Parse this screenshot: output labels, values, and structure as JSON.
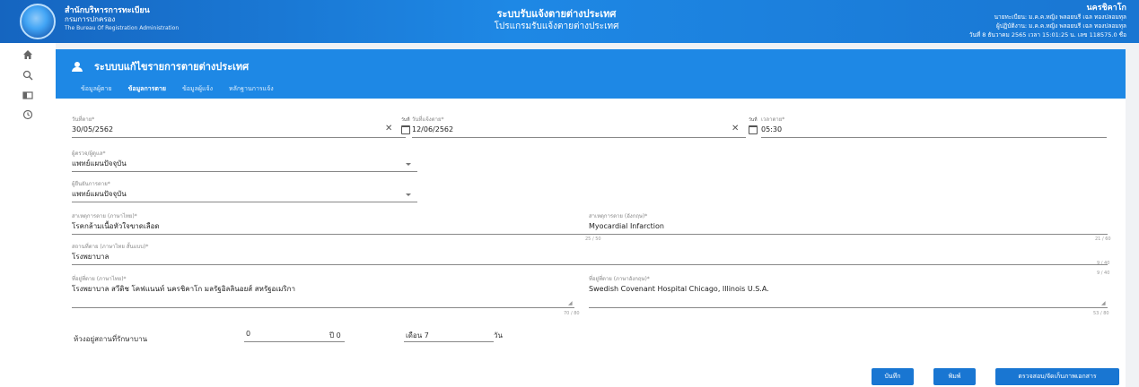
{
  "header": {
    "org_line1": "สำนักบริหารการทะเบียน",
    "org_line2": "กรมการปกครอง",
    "org_line3": "The Bureau Of Registration Administration",
    "title_line1": "ระบบรับแจ้งตายต่างประเทศ",
    "title_line2": "โปรแกรมรับแจ้งตายต่างประเทศ",
    "user_name": "นครชิคาโก",
    "user_line2": "นายทะเบียน: ม.ค.ค.หญิง พลอยนรี เฉล ทองปลอมทุล",
    "user_line3": "ผู้ปฏิบัติงาน: ม.ค.ค.หญิง พลอยนรี เฉล ทองปลอมทุล",
    "user_line4": "วันที่ 8 ธันวาคม 2565 เวลา 15:01:25 น. เลข 118575.0 ชื่อ"
  },
  "rail": {
    "icons": [
      "home-icon",
      "search-icon",
      "card-icon",
      "history-icon"
    ]
  },
  "panel": {
    "title": "ระบบบแก้ไขรายการตายต่างประเทศ",
    "tabs": [
      "ข้อมูลผู้ตาย",
      "ข้อมูลการตาย",
      "ข้อมูลผู้แจ้ง",
      "หลักฐานการแจ้ง"
    ],
    "active_tab": 1
  },
  "form": {
    "death_date": {
      "label": "วันที่ตาย*",
      "value": "30/05/2562"
    },
    "report_date": {
      "label": "วันที่แจ้งตาย*",
      "value": "12/06/2562",
      "cal_caption": "วันที่"
    },
    "death_time": {
      "label": "เวลาตาย*",
      "value": "05:30",
      "cal_caption": "วันที่"
    },
    "death_type": {
      "label": "ผู้ตรวจ/ผู้ดูแล*",
      "value": "แพทย์แผนปัจจุบัน"
    },
    "certifier": {
      "label": "ผู้ยืนยันการตาย*",
      "value": "แพทย์แผนปัจจุบัน"
    },
    "cause_th": {
      "label": "สาเหตุการตาย (ภาษาไทย)*",
      "value": "โรคกล้ามเนื้อหัวใจขาดเลือด",
      "counter": "25 / 50"
    },
    "cause_en": {
      "label": "สาเหตุการตาย (อังกฤษ)*",
      "value": "Myocardial Infarction",
      "counter": "21 / 60"
    },
    "place_short": {
      "label": "สถานที่ตาย (ภาษาไทย สั้นแบบ)*",
      "value": "โรงพยาบาล",
      "counter": "9 / 40"
    },
    "place_th": {
      "label": "ที่อยู่ที่ตาย (ภาษาไทย)*",
      "value": "โรงพยาบาล สวีดิช โคฟแนนท์  นครชิคาโก มลรัฐอิลลินอยส์  สหรัฐอเมริกา",
      "counter": "70 / 80"
    },
    "place_en": {
      "label": "ที่อยู่ที่ตาย (ภาษาอังกฤษ)*",
      "value": "Swedish Covenant Hospital  Chicago, Illinois    U.S.A.",
      "counter": "53 / 80"
    },
    "extra_counter": "9 / 40",
    "duration": {
      "label": "ห้วงอยู่สถานที่รักษาบาน",
      "years": "0",
      "years_unit": "ปี 0",
      "months_label": "เดือน 7",
      "days_unit": "วัน"
    }
  },
  "footer": {
    "save": "บันทึก",
    "print": "พิมพ์",
    "verify": "ตรวจสอบ/จัดเก็บภาพเอกสาร"
  }
}
